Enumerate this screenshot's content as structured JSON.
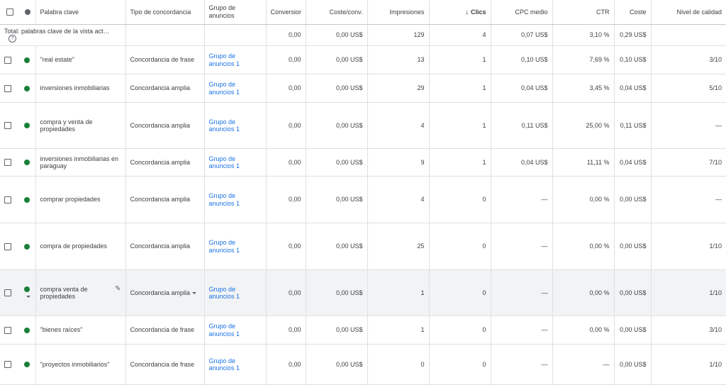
{
  "headers": {
    "keyword": "Palabra clave",
    "match_type": "Tipo de concordancia",
    "ad_group": "Grupo de anuncios",
    "conversions": "Conversior",
    "cost_conv": "Coste/conv.",
    "impressions": "Impresiones",
    "clicks": "Clics",
    "avg_cpc": "CPC medio",
    "ctr": "CTR",
    "cost": "Coste",
    "quality": "Nivel de calidad"
  },
  "total": {
    "label": "Total: palabras clave de la vista act…",
    "conversions": "0,00",
    "cost_conv": "0,00 US$",
    "impressions": "129",
    "clicks": "4",
    "avg_cpc": "0,07 US$",
    "ctr": "3,10 %",
    "cost": "0,29 US$",
    "quality": ""
  },
  "rows": [
    {
      "keyword": "\"real estate\"",
      "match": "Concordancia de frase",
      "group": "Grupo de anuncios 1",
      "conversions": "0,00",
      "cost_conv": "0,00 US$",
      "impressions": "13",
      "clicks": "1",
      "avg_cpc": "0,10 US$",
      "ctr": "7,69 %",
      "cost": "0,10 US$",
      "quality": "3/10"
    },
    {
      "keyword": "inversiones inmobiliarias",
      "match": "Concordancia amplia",
      "group": "Grupo de anuncios 1",
      "conversions": "0,00",
      "cost_conv": "0,00 US$",
      "impressions": "29",
      "clicks": "1",
      "avg_cpc": "0,04 US$",
      "ctr": "3,45 %",
      "cost": "0,04 US$",
      "quality": "5/10"
    },
    {
      "keyword": "compra y venta de propiedades",
      "match": "Concordancia amplia",
      "group": "Grupo de anuncios 1",
      "conversions": "0,00",
      "cost_conv": "0,00 US$",
      "impressions": "4",
      "clicks": "1",
      "avg_cpc": "0,11 US$",
      "ctr": "25,00 %",
      "cost": "0,11 US$",
      "quality": "—"
    },
    {
      "keyword": "inversiones inmobiliarias en paraguay",
      "match": "Concordancia amplia",
      "group": "Grupo de anuncios 1",
      "conversions": "0,00",
      "cost_conv": "0,00 US$",
      "impressions": "9",
      "clicks": "1",
      "avg_cpc": "0,04 US$",
      "ctr": "11,11 %",
      "cost": "0,04 US$",
      "quality": "7/10"
    },
    {
      "keyword": "comprar propiedades",
      "match": "Concordancia amplia",
      "group": "Grupo de anuncios 1",
      "conversions": "0,00",
      "cost_conv": "0,00 US$",
      "impressions": "4",
      "clicks": "0",
      "avg_cpc": "—",
      "ctr": "0,00 %",
      "cost": "0,00 US$",
      "quality": "—"
    },
    {
      "keyword": "compra de propiedades",
      "match": "Concordancia amplia",
      "group": "Grupo de anuncios 1",
      "conversions": "0,00",
      "cost_conv": "0,00 US$",
      "impressions": "25",
      "clicks": "0",
      "avg_cpc": "—",
      "ctr": "0,00 %",
      "cost": "0,00 US$",
      "quality": "1/10"
    },
    {
      "keyword": "compra venta de propiedades",
      "match": "Concordancia amplia",
      "group": "Grupo de anuncios 1",
      "conversions": "0,00",
      "cost_conv": "0,00 US$",
      "impressions": "1",
      "clicks": "0",
      "avg_cpc": "—",
      "ctr": "0,00 %",
      "cost": "0,00 US$",
      "quality": "1/10"
    },
    {
      "keyword": "\"bienes raíces\"",
      "match": "Concordancia de frase",
      "group": "Grupo de anuncios 1",
      "conversions": "0,00",
      "cost_conv": "0,00 US$",
      "impressions": "1",
      "clicks": "0",
      "avg_cpc": "—",
      "ctr": "0,00 %",
      "cost": "0,00 US$",
      "quality": "3/10"
    },
    {
      "keyword": "\"proyectos inmobiliarios\"",
      "match": "Concordancia de frase",
      "group": "Grupo de anuncios 1",
      "conversions": "0,00",
      "cost_conv": "0,00 US$",
      "impressions": "0",
      "clicks": "0",
      "avg_cpc": "—",
      "ctr": "—",
      "cost": "0,00 US$",
      "quality": "1/10"
    }
  ],
  "colors": {
    "status_enabled": "#188038",
    "link": "#1a73e8",
    "hover_row": "#f1f3f4"
  },
  "icons": {
    "sort": "arrow-down-icon",
    "edit": "pencil-icon",
    "help": "help-icon",
    "status": "status-dot-icon"
  }
}
